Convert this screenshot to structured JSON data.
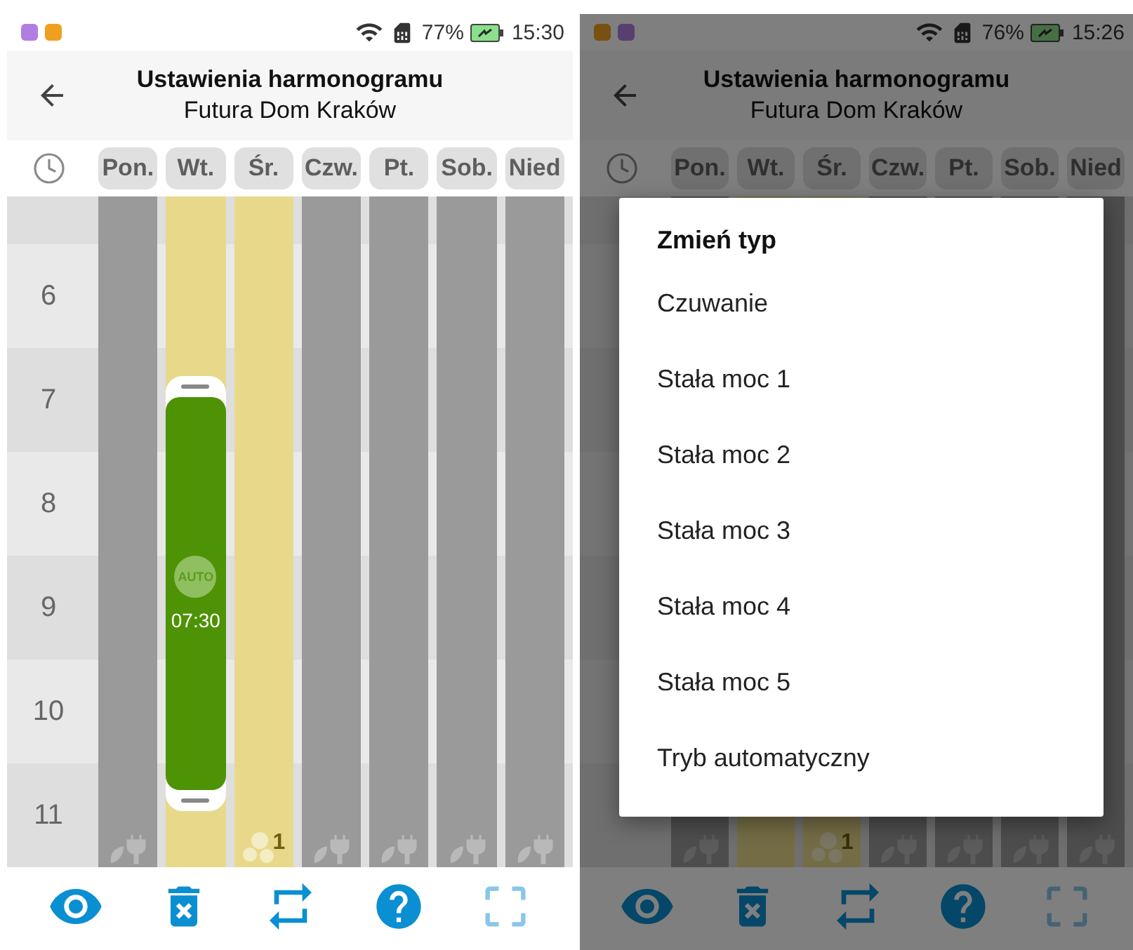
{
  "screens": [
    {
      "status_bar": {
        "apps": [
          {
            "kind": "gallery"
          },
          {
            "kind": "clock"
          }
        ],
        "battery": "77%",
        "time": "15:30"
      },
      "header": {
        "title": "Ustawienia harmonogramu",
        "subtitle": "Futura Dom Kraków"
      },
      "days": [
        {
          "label": "Pon.",
          "kind": "plug"
        },
        {
          "label": "Wt.",
          "kind": "empty",
          "block": {
            "badge": "AUTO",
            "time": "07:30"
          }
        },
        {
          "label": "Śr.",
          "kind": "fan",
          "badge": "1"
        },
        {
          "label": "Czw.",
          "kind": "plug"
        },
        {
          "label": "Pt.",
          "kind": "plug"
        },
        {
          "label": "Sob.",
          "kind": "plug"
        },
        {
          "label": "Nied",
          "kind": "plug"
        }
      ],
      "hours": [
        "6",
        "7",
        "8",
        "9",
        "10",
        "11"
      ],
      "actions": [
        {
          "kind": "eye",
          "disabled": false
        },
        {
          "kind": "delete",
          "disabled": false
        },
        {
          "kind": "repeat",
          "disabled": false
        },
        {
          "kind": "help",
          "disabled": false
        },
        {
          "kind": "expand",
          "disabled": true
        }
      ]
    },
    {
      "status_bar": {
        "apps": [
          {
            "kind": "clock"
          },
          {
            "kind": "gallery"
          }
        ],
        "battery": "76%",
        "time": "15:26"
      },
      "header": {
        "title": "Ustawienia harmonogramu",
        "subtitle": "Futura Dom Kraków"
      },
      "days": [
        {
          "label": "Pon.",
          "kind": "plug"
        },
        {
          "label": "Wt.",
          "kind": "empty"
        },
        {
          "label": "Śr.",
          "kind": "fan",
          "badge": "1"
        },
        {
          "label": "Czw.",
          "kind": "plug"
        },
        {
          "label": "Pt.",
          "kind": "plug"
        },
        {
          "label": "Sob.",
          "kind": "plug"
        },
        {
          "label": "Nied",
          "kind": "plug"
        }
      ],
      "actions": [
        {
          "kind": "eye",
          "disabled": false
        },
        {
          "kind": "delete",
          "disabled": false
        },
        {
          "kind": "repeat",
          "disabled": false
        },
        {
          "kind": "help",
          "disabled": false
        },
        {
          "kind": "expand",
          "disabled": true
        }
      ],
      "dialog": {
        "title": "Zmień typ",
        "options": [
          "Czuwanie",
          "Stała moc 1",
          "Stała moc 2",
          "Stała moc 3",
          "Stała moc 4",
          "Stała moc 5",
          "Tryb automatyczny"
        ]
      }
    }
  ]
}
